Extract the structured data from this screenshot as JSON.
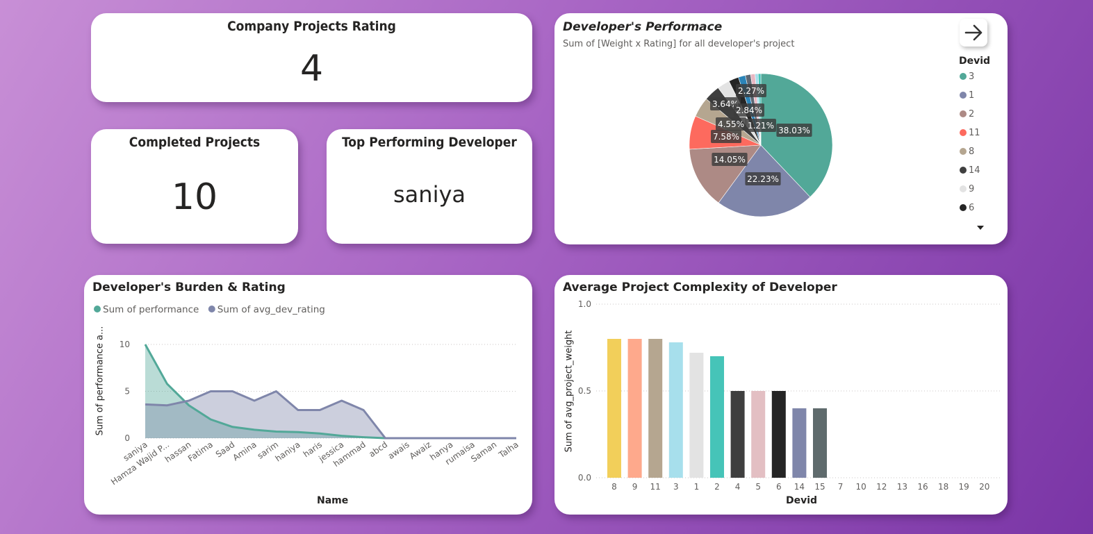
{
  "kpis": {
    "rating": {
      "title": "Company Projects Rating",
      "value": "4"
    },
    "completed": {
      "title": "Completed Projects",
      "value": "10"
    },
    "top_dev": {
      "title": "Top Performing Developer",
      "value": "saniya"
    }
  },
  "pie": {
    "title": "Developer's Performace",
    "subtitle": "Sum of [Weight x Rating] for all developer's project",
    "legend_title": "Devid"
  },
  "line": {
    "title": "Developer's Burden & Rating",
    "xlabel": "Name",
    "ylabel": "Sum of performance a..."
  },
  "bar": {
    "title": "Average Project Complexity of Developer",
    "xlabel": "Devid",
    "ylabel": "Sum of avg_project_weight"
  },
  "colors": {
    "teal": "#52a898",
    "slate": "#7f86aa",
    "mauve": "#ad8a85",
    "coral": "#fd6a5e",
    "tan": "#b5a690",
    "charcoal": "#3f3f3f"
  },
  "chart_data": [
    {
      "type": "pie",
      "title": "Developer's Performace",
      "subtitle": "Sum of [Weight x Rating] for all developer's project",
      "legend_title": "Devid",
      "slices": [
        {
          "label": "3",
          "value": 38.03,
          "color": "#52a898",
          "shown": "38.03%"
        },
        {
          "label": "1",
          "value": 22.23,
          "color": "#7f86aa",
          "shown": "22.23%"
        },
        {
          "label": "2",
          "value": 14.05,
          "color": "#ad8a85",
          "shown": "14.05%"
        },
        {
          "label": "11",
          "value": 7.58,
          "color": "#fd6a5e",
          "shown": "7.58%"
        },
        {
          "label": "8",
          "value": 4.55,
          "color": "#b5a690",
          "shown": "4.55%"
        },
        {
          "label": "14",
          "value": 3.64,
          "color": "#3f3f3f",
          "shown": "3.64%"
        },
        {
          "label": "9",
          "value": 2.84,
          "color": "#e3e3e3",
          "shown": "2.84%"
        },
        {
          "label": "6",
          "value": 2.27,
          "color": "#252525",
          "shown": "2.27%"
        },
        {
          "label": "",
          "value": 1.6,
          "color": "#2b84b8",
          "shown": ""
        },
        {
          "label": "",
          "value": 1.21,
          "color": "#5c6773",
          "shown": "1.21%"
        },
        {
          "label": "",
          "value": 1.0,
          "color": "#e8b7c2",
          "shown": ""
        },
        {
          "label": "",
          "value": 0.7,
          "color": "#a7dfec",
          "shown": ""
        },
        {
          "label": "",
          "value": 0.6,
          "color": "#46c4b8",
          "shown": ""
        }
      ],
      "legend": [
        "3",
        "1",
        "2",
        "11",
        "8",
        "14",
        "9",
        "6"
      ]
    },
    {
      "type": "area",
      "title": "Developer's Burden & Rating",
      "xlabel": "Name",
      "ylabel": "Sum of performance a...",
      "categories": [
        "saniya",
        "Hamza Wajid P...",
        "hassan",
        "Fatima",
        "Saad",
        "Amina",
        "sarim",
        "haniya",
        "haris",
        "jessica",
        "hammad",
        "abcd",
        "awais",
        "Awaiz",
        "hanya",
        "rumaisa",
        "Saman",
        "Talha"
      ],
      "yticks": [
        0,
        5,
        10
      ],
      "ylim": [
        0,
        11
      ],
      "series": [
        {
          "name": "Sum of performance",
          "color": "#52a898",
          "values": [
            10,
            5.8,
            3.5,
            2,
            1.2,
            0.9,
            0.7,
            0.65,
            0.5,
            0.25,
            0.1,
            0,
            0,
            0,
            0,
            0,
            0,
            0
          ]
        },
        {
          "name": "Sum of avg_dev_rating",
          "color": "#7f86aa",
          "values": [
            3.6,
            3.5,
            4,
            5,
            5,
            4,
            5,
            3,
            3,
            4,
            3,
            0,
            0,
            0,
            0,
            0,
            0,
            0
          ]
        }
      ],
      "legend_position": "top-left"
    },
    {
      "type": "bar",
      "title": "Average Project Complexity of Developer",
      "xlabel": "Devid",
      "ylabel": "Sum of avg_project_weight",
      "categories": [
        "8",
        "9",
        "11",
        "3",
        "1",
        "2",
        "4",
        "5",
        "6",
        "14",
        "15",
        "7",
        "10",
        "12",
        "13",
        "16",
        "18",
        "19",
        "20"
      ],
      "values": [
        0.8,
        0.8,
        0.8,
        0.78,
        0.72,
        0.7,
        0.5,
        0.5,
        0.5,
        0.4,
        0.4,
        0,
        0,
        0,
        0,
        0,
        0,
        0,
        0
      ],
      "colors": [
        "#f2cf5a",
        "#fea98c",
        "#b5a690",
        "#a7dfec",
        "#e3e3e3",
        "#46c4b8",
        "#3f3f3f",
        "#e3bfc3",
        "#252525",
        "#7f86aa",
        "#5f6b6d",
        "#cccccc",
        "#cccccc",
        "#cccccc",
        "#cccccc",
        "#cccccc",
        "#cccccc",
        "#cccccc",
        "#cccccc"
      ],
      "ytick_labels": [
        "0.0",
        "0.5",
        "1.0"
      ],
      "ylim": [
        0,
        1
      ]
    }
  ]
}
